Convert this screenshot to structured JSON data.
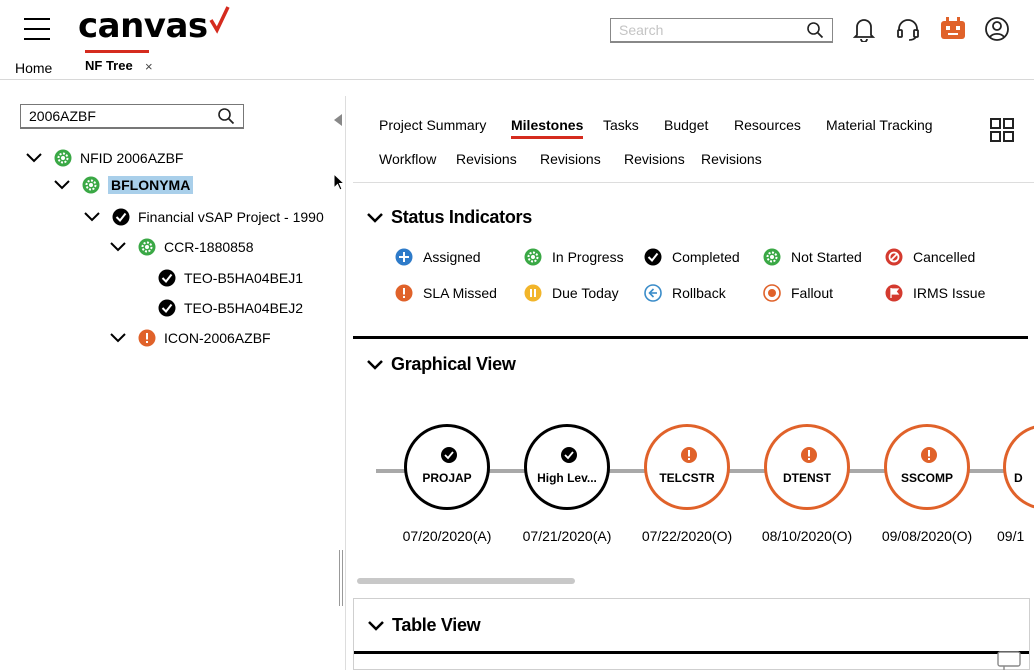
{
  "header": {
    "logo_text": "canvas",
    "brand_color": "#d52b1e",
    "search_placeholder": "Search",
    "icons": [
      "bell-icon",
      "headset-icon",
      "bot-icon",
      "user-icon"
    ]
  },
  "nav": {
    "home_label": "Home",
    "tab_label": "NF Tree",
    "close_label": "×"
  },
  "tree": {
    "search_value": "2006AZBF",
    "nodes": [
      {
        "label": "NFID 2006AZBF",
        "status": "in-progress",
        "expanded": true
      },
      {
        "label": "BFLONYMA",
        "status": "in-progress",
        "expanded": true,
        "selected": true
      },
      {
        "label": "Financial vSAP Project - 1990",
        "status": "completed",
        "expanded": true
      },
      {
        "label": "CCR-1880858",
        "status": "in-progress",
        "expanded": true
      },
      {
        "label": "TEO-B5HA04BEJ1",
        "status": "completed"
      },
      {
        "label": "TEO-B5HA04BEJ2",
        "status": "completed"
      },
      {
        "label": "ICON-2006AZBF",
        "status": "sla-missed",
        "expanded": true
      }
    ]
  },
  "tabs": {
    "row1": [
      "Project Summary",
      "Milestones",
      "Tasks",
      "Budget",
      "Resources",
      "Material Tracking"
    ],
    "row2": [
      "Workflow",
      "Revisions",
      "Revisions",
      "Revisions",
      "Revisions"
    ],
    "active": "Milestones"
  },
  "status_indicators": {
    "title": "Status Indicators",
    "items": [
      {
        "label": "Assigned",
        "icon": "plus-circle-icon",
        "color": "#2e7bc9"
      },
      {
        "label": "In Progress",
        "icon": "gear-circle-icon",
        "color": "#3aa845"
      },
      {
        "label": "Completed",
        "icon": "check-circle-icon",
        "color": "#000000"
      },
      {
        "label": "Not Started",
        "icon": "gear-circle-icon",
        "color": "#3aa845"
      },
      {
        "label": "Cancelled",
        "icon": "cancel-circle-icon",
        "color": "#d43a2f"
      },
      {
        "label": "SLA Missed",
        "icon": "exclamation-circle-icon",
        "color": "#e0622a"
      },
      {
        "label": "Due Today",
        "icon": "pause-circle-icon",
        "color": "#f2b52a"
      },
      {
        "label": "Rollback",
        "icon": "arrow-left-circle-icon",
        "color": "#3a8cc9"
      },
      {
        "label": "Fallout",
        "icon": "target-circle-icon",
        "color": "#e0622a"
      },
      {
        "label": "IRMS Issue",
        "icon": "flag-circle-icon",
        "color": "#d43a2f"
      }
    ]
  },
  "graphical_view": {
    "title": "Graphical View",
    "milestones": [
      {
        "label": "PROJAP",
        "date": "07/20/2020(A)",
        "status": "completed"
      },
      {
        "label": "High Lev...",
        "date": "07/21/2020(A)",
        "status": "completed"
      },
      {
        "label": "TELCSTR",
        "date": "07/22/2020(O)",
        "status": "sla-missed"
      },
      {
        "label": "DTENST",
        "date": "08/10/2020(O)",
        "status": "sla-missed"
      },
      {
        "label": "SSCOMP",
        "date": "09/08/2020(O)",
        "status": "sla-missed"
      },
      {
        "label": "D",
        "date": "09/1",
        "status": "sla-missed"
      }
    ]
  },
  "table_view": {
    "title": "Table View"
  }
}
